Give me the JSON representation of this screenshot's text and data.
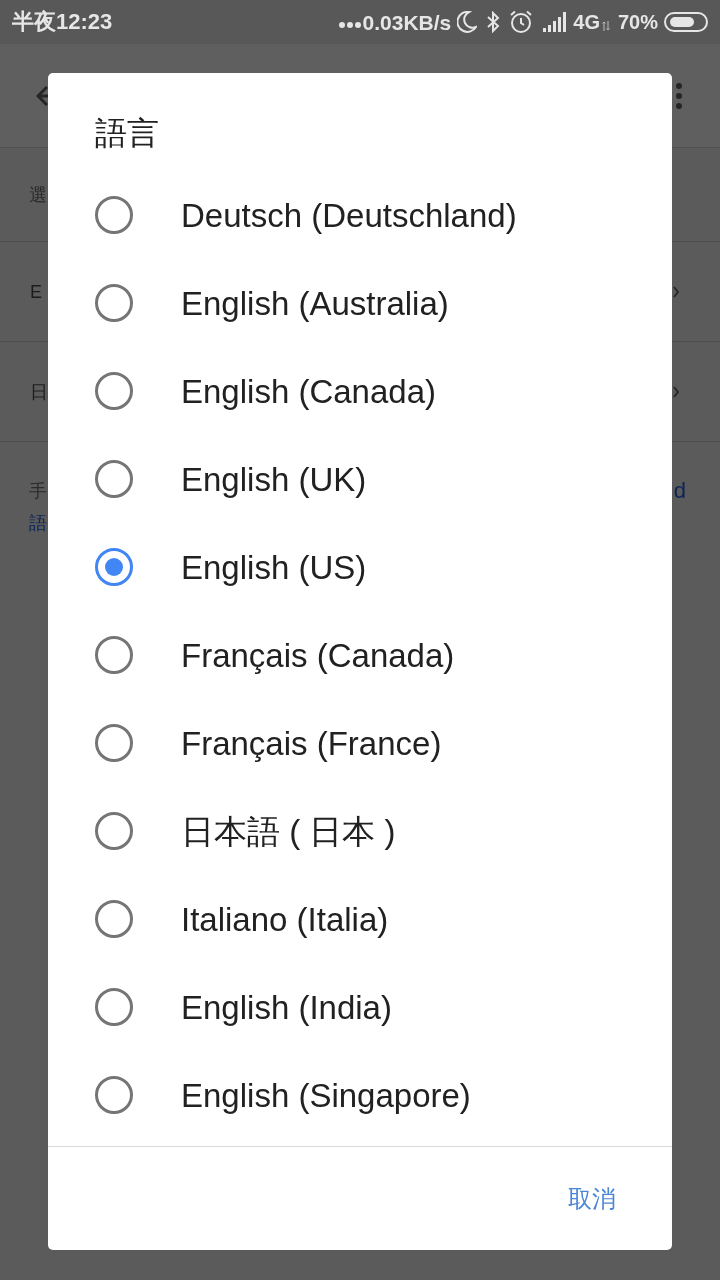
{
  "status_bar": {
    "time": "半夜12:23",
    "network_speed": "0.03KB/s",
    "network_type": "4G",
    "battery": "70%"
  },
  "background_page": {
    "rows": [
      {
        "kind": "header",
        "text": "選"
      },
      {
        "kind": "option",
        "text": "E"
      },
      {
        "kind": "option",
        "text": "日"
      },
      {
        "kind": "note",
        "text": "手",
        "link_line_end": "d",
        "link_line_start": "語"
      }
    ]
  },
  "dialog": {
    "title": "語言",
    "options": [
      {
        "label": "Deutsch (Deutschland)",
        "selected": false
      },
      {
        "label": "English (Australia)",
        "selected": false
      },
      {
        "label": "English (Canada)",
        "selected": false
      },
      {
        "label": "English (UK)",
        "selected": false
      },
      {
        "label": "English (US)",
        "selected": true
      },
      {
        "label": "Français (Canada)",
        "selected": false
      },
      {
        "label": "Français (France)",
        "selected": false
      },
      {
        "label": "日本語 ( 日本 )",
        "selected": false
      },
      {
        "label": "Italiano (Italia)",
        "selected": false
      },
      {
        "label": "English (India)",
        "selected": false
      },
      {
        "label": "English (Singapore)",
        "selected": false
      }
    ],
    "buttons": [
      {
        "label": "取消"
      }
    ]
  }
}
